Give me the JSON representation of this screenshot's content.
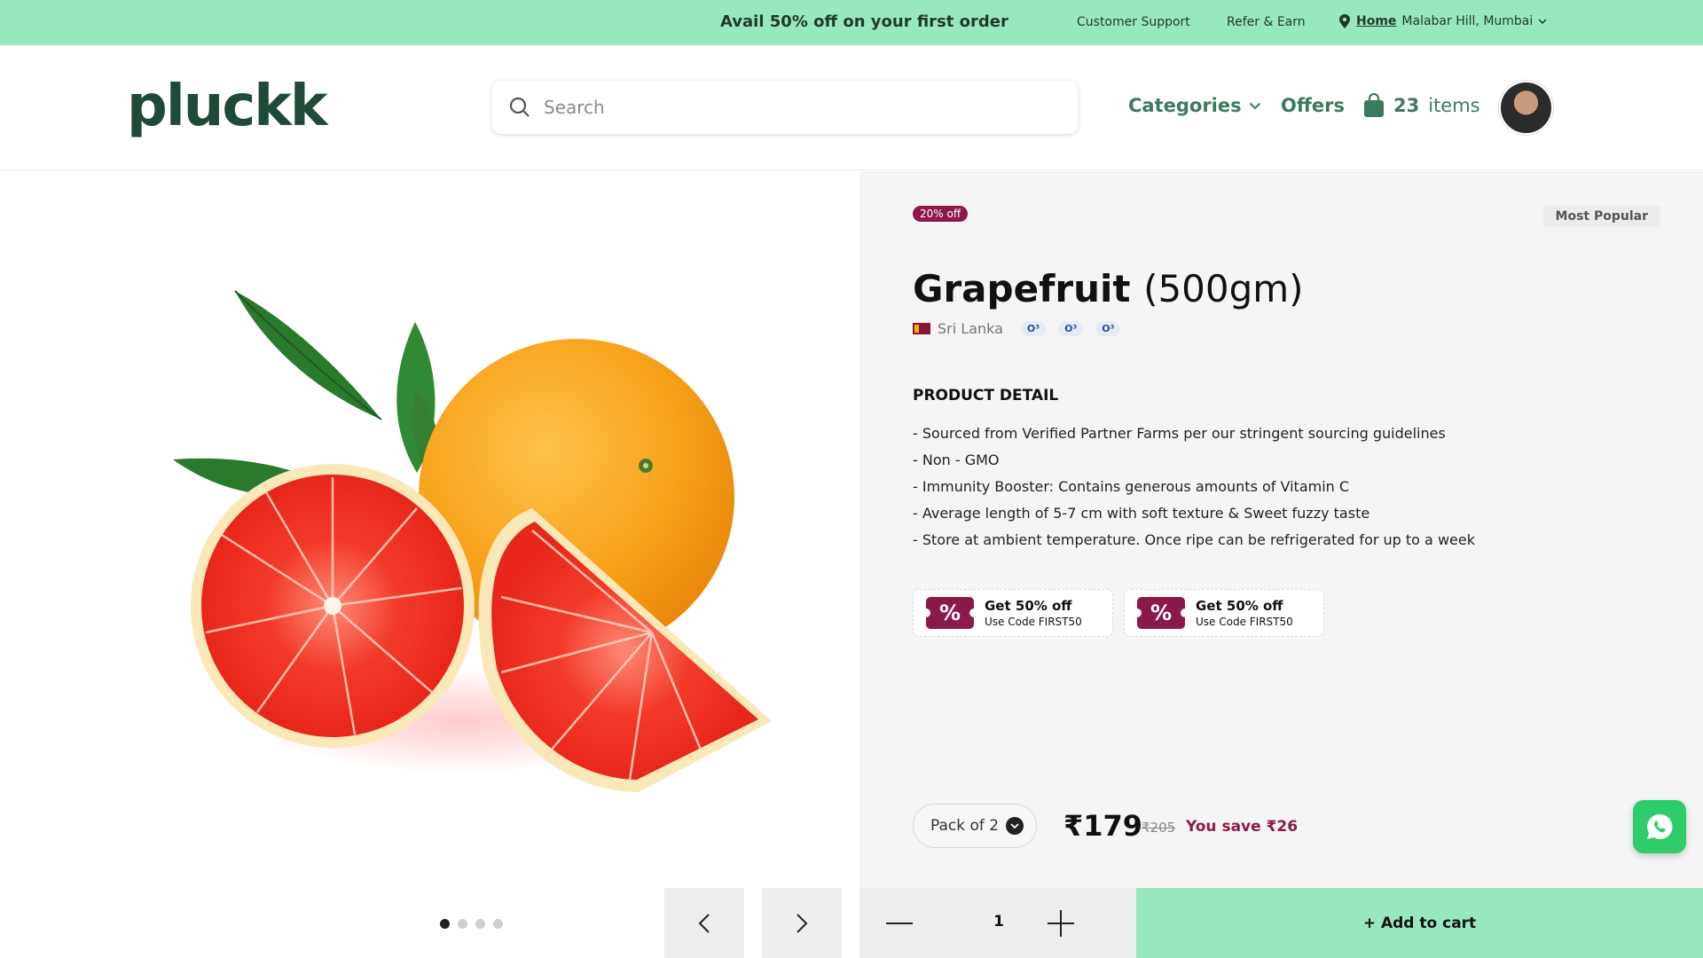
{
  "promo": {
    "text": "Avail 50% off on your first order",
    "links": [
      "Customer Support",
      "Refer & Earn"
    ],
    "location_label": "Home",
    "location_value": "Malabar Hill, Mumbai"
  },
  "header": {
    "logo": "pluckk",
    "search_placeholder": "Search",
    "nav": [
      "Categories",
      "Offers"
    ],
    "cart_count": "23",
    "cart_label": "items"
  },
  "product": {
    "discount_badge": "20% off",
    "popular_badge": "Most Popular",
    "name": "Grapefruit",
    "weight": "(500gm)",
    "origin": "Sri Lanka",
    "certifications": [
      "O³",
      "O³",
      "O³"
    ],
    "detail_title": "PRODUCT DETAIL",
    "details": [
      "- Sourced from Verified Partner Farms per our stringent sourcing guidelines",
      "- Non - GMO",
      "- Immunity Booster: Contains generous amounts of Vitamin C",
      "- Average length of 5-7 cm with soft texture & Sweet fuzzy taste",
      "- Store at ambient temperature. Once ripe can be refrigerated for up to a week"
    ],
    "coupons": [
      {
        "icon": "%",
        "title": "Get 50% off",
        "code": "Use Code FIRST50"
      },
      {
        "icon": "%",
        "title": "Get 50% off",
        "code": "Use Code FIRST50"
      }
    ],
    "pack": "Pack of 2",
    "price": "₹179",
    "mrp": "₹205",
    "savings": "You save ₹26"
  },
  "gallery": {
    "slides": 4,
    "active": 0
  },
  "cart_actions": {
    "quantity": "1",
    "add_label": "+ Add to cart"
  },
  "colors": {
    "accent": "#98E8BF",
    "brand": "#1e4a38",
    "nav_green": "#3c7a5e",
    "offer_maroon": "#8b1a4b"
  },
  "icons": [
    "search-icon",
    "location-pin-icon",
    "chevron-down-icon",
    "shopping-bag-icon",
    "chevron-left-icon",
    "chevron-right-icon",
    "minus-icon",
    "plus-icon",
    "percent-coupon-icon",
    "whatsapp-icon"
  ]
}
